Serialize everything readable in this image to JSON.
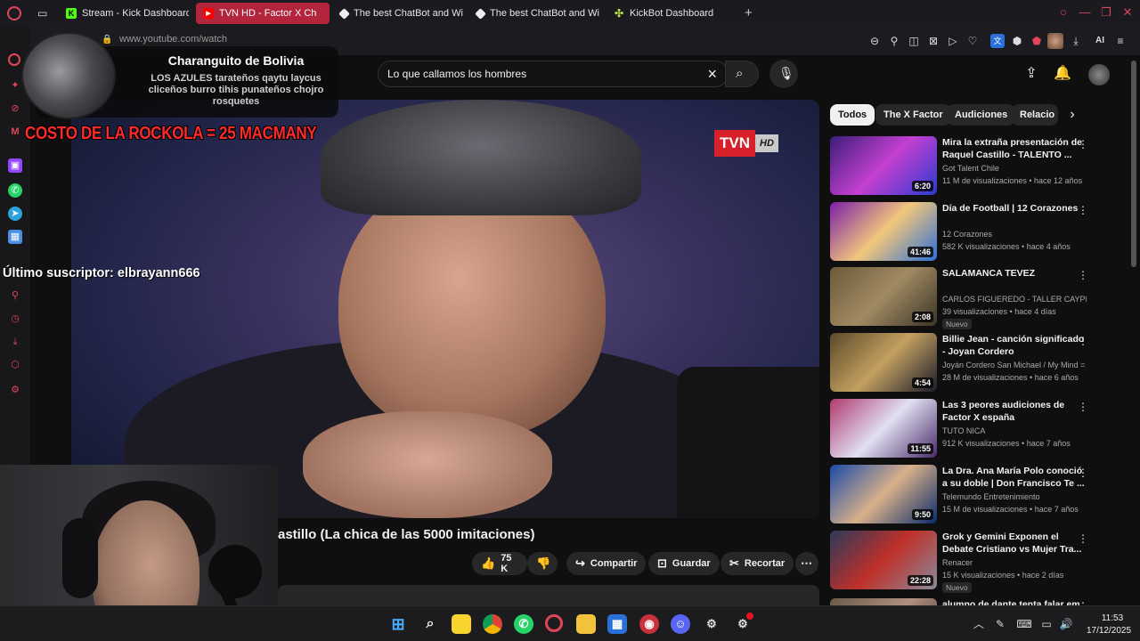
{
  "browser": {
    "tabs": [
      {
        "title": "Stream - Kick Dashboard",
        "icon": "kick-icon",
        "active": false
      },
      {
        "title": "TVN HD - Factor X Ch",
        "icon": "youtube-icon",
        "active": true
      },
      {
        "title": "The best ChatBot and Wi",
        "icon": "chatbot-icon",
        "active": false
      },
      {
        "title": "The best ChatBot and Wi",
        "icon": "chatbot-icon",
        "active": false
      },
      {
        "title": "KickBot Dashboard",
        "icon": "kickbot-icon",
        "active": false
      }
    ],
    "url": "www.youtube.com/watch",
    "ai_label": "AI"
  },
  "youtube": {
    "search_query": "Lo que callamos los hombres",
    "video_title": "astillo (La chica de las 5000 imitaciones)",
    "channel_logo": {
      "main": "TVN",
      "sub": "HD"
    },
    "actions": {
      "likes": "75 K",
      "share": "Compartir",
      "save": "Guardar",
      "clip": "Recortar"
    },
    "chips": [
      "Todos",
      "The X Factor",
      "Audiciones",
      "Relacio"
    ],
    "recommendations": [
      {
        "title": "Mira la extraña presentación de Raquel Castillo - TALENTO ...",
        "channel": "Got Talent Chile",
        "meta": "11 M de visualizaciones • hace 12 años",
        "duration": "6:20",
        "badge": "",
        "thumb_colors": [
          "#3a1d78",
          "#c43fd0",
          "#2a3bd0"
        ]
      },
      {
        "title": "Día de Football | 12 Corazones",
        "channel": "12 Corazones",
        "meta": "582 K visualizaciones • hace 4 años",
        "duration": "41:46",
        "badge": "",
        "thumb_colors": [
          "#7a1fa8",
          "#f2c77a",
          "#2f6fd8"
        ]
      },
      {
        "title": "SALAMANCA TEVEZ",
        "channel": "CARLOS FIGUEREDO - TALLER CAYPI QU...",
        "meta": "39 visualizaciones • hace 4 días",
        "duration": "2:08",
        "badge": "Nuevo",
        "thumb_colors": [
          "#6b5a3a",
          "#a08a62",
          "#3a3328"
        ]
      },
      {
        "title": "Billie Jean - canción significado - Joyan Cordero",
        "channel": "Joyán Cordero San Michael / My Mind = ...",
        "meta": "28 M de visualizaciones • hace 6 años",
        "duration": "4:54",
        "badge": "",
        "thumb_colors": [
          "#5a4a2a",
          "#c4a060",
          "#1a1a2a"
        ]
      },
      {
        "title": "Las 3 peores audiciones de Factor X españa",
        "channel": "TUTO NICA",
        "meta": "912 K visualizaciones • hace 7 años",
        "duration": "11:55",
        "badge": "",
        "thumb_colors": [
          "#b03a70",
          "#e0e0f0",
          "#4a2a6a"
        ]
      },
      {
        "title": "La Dra. Ana María Polo conoció a su doble | Don Francisco Te ...",
        "channel": "Telemundo Entretenimiento",
        "meta": "15 M de visualizaciones • hace 7 años",
        "duration": "9:50",
        "badge": "",
        "thumb_colors": [
          "#1a4aa8",
          "#d8b08a",
          "#0a2a6a"
        ]
      },
      {
        "title": "Grok y Gemini Exponen el Debate Cristiano vs Mujer Tra...",
        "channel": "Renacer",
        "meta": "15 K visualizaciones • hace 2 días",
        "duration": "22:28",
        "badge": "Nuevo",
        "thumb_colors": [
          "#2a3a5a",
          "#c0302a",
          "#8a8a9a"
        ]
      },
      {
        "title": "alumno de dante tenta falar em",
        "channel": "",
        "meta": "",
        "duration": "",
        "badge": "",
        "thumb_colors": [
          "#6a5a4a",
          "#b09080",
          "#3a2a2a"
        ]
      }
    ]
  },
  "overlay": {
    "chat_user": "Charanguito de Bolivia",
    "chat_message": "LOS AZULES tarateños qaytu laycus cliceños burro tihis punateños chojro rosquetes",
    "rockola": "COSTO DE LA ROCKOLA = 25 MACMANY",
    "last_subscriber": "Último suscriptor: elbrayann666"
  },
  "taskbar": {
    "time": "11:53",
    "date": "17/12/2025"
  },
  "colors": {
    "brand_red": "#ff0000",
    "tab_active": "#b3243d",
    "rockola_red": "#ff2a2a",
    "kick_green": "#53fc18"
  }
}
